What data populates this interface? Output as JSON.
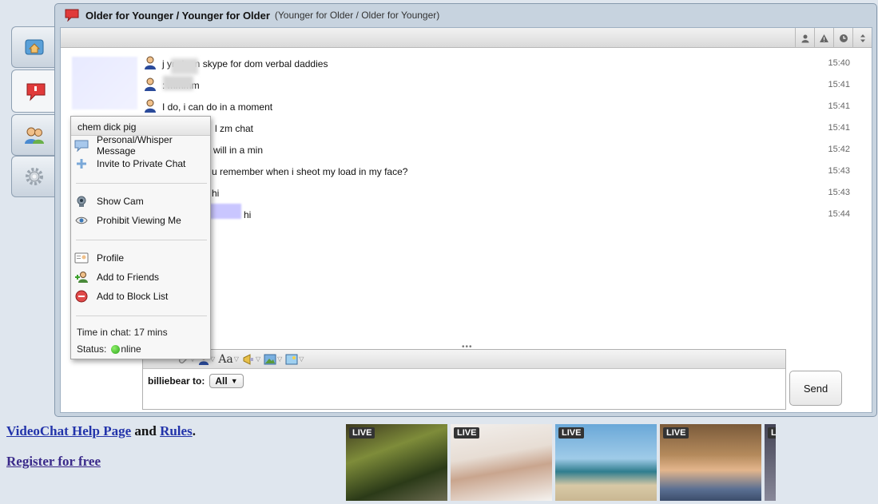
{
  "window": {
    "title": "Older for Younger / Younger for Older",
    "subtitle": "(Younger for Older / Older for Younger)"
  },
  "side_tabs": [
    {
      "name": "home-tab",
      "icon": "home-icon"
    },
    {
      "name": "chat-tab",
      "icon": "speech-bubble-icon",
      "active": true
    },
    {
      "name": "users-tab",
      "icon": "users-icon"
    },
    {
      "name": "settings-tab",
      "icon": "gear-icon"
    }
  ],
  "toolbar": {
    "buttons": [
      "user-icon",
      "warning-icon",
      "clock-icon",
      "sort-icon"
    ]
  },
  "messages": [
    {
      "text": "j         ynsk on skype for dom verbal daddies",
      "time": "15:40"
    },
    {
      "text": "         : mmmm",
      "time": "15:41"
    },
    {
      "text": "I do, i can do in a moment",
      "time": "15:41"
    },
    {
      "text": "l zm chat",
      "time": "15:41"
    },
    {
      "text": "will in a min",
      "time": "15:42"
    },
    {
      "text": "u remember when i sheot my load in my face?",
      "time": "15:43"
    },
    {
      "text": "hi",
      "time": "15:43"
    },
    {
      "text": "hi",
      "time": "15:44"
    }
  ],
  "context_menu": {
    "username": "chem dick pig",
    "items": {
      "whisper": "Personal/Whisper Message",
      "invite": "Invite to Private Chat",
      "show_cam": "Show Cam",
      "prohibit": "Prohibit Viewing Me",
      "profile": "Profile",
      "add_friends": "Add to Friends",
      "block": "Add to Block List"
    },
    "time_in_chat": "Time in chat: 17 mins",
    "status_label": "Status:",
    "status_value": "nline"
  },
  "composer": {
    "to_label": "billiebear to:",
    "recipient": "All",
    "send_label": "Send",
    "font_label": "Aa"
  },
  "footer": {
    "help_link": "VideoChat Help Page",
    "and_text": "and",
    "rules_link": "Rules",
    "period": ".",
    "register_link": "Register for free"
  },
  "thumbnails": [
    {
      "badge": "LIVE"
    },
    {
      "badge": "LIVE"
    },
    {
      "badge": "LIVE"
    },
    {
      "badge": "LIVE"
    },
    {
      "badge": "LIVE"
    }
  ]
}
